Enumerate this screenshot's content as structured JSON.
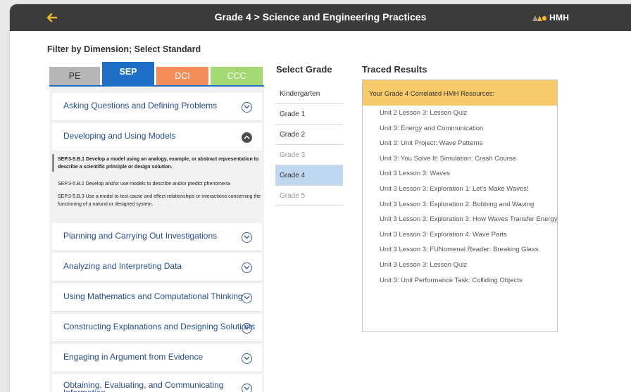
{
  "header": {
    "title": "Grade 4 > Science and Engineering Practices",
    "logo_text": "HMH"
  },
  "filter_label": "Filter by Dimension; Select Standard",
  "tabs": [
    {
      "label": "PE",
      "color": "#b6b6b6"
    },
    {
      "label": "SEP",
      "color": "#1f6fc8"
    },
    {
      "label": "DCI",
      "color": "#f58d5a"
    },
    {
      "label": "CCC",
      "color": "#a5d873"
    }
  ],
  "standards": [
    {
      "label": "Asking Questions and Defining Problems"
    },
    {
      "label": "Developing and Using Models"
    },
    {
      "label": "Planning and Carrying Out Investigations"
    },
    {
      "label": "Analyzing and Interpreting Data"
    },
    {
      "label": "Using Mathematics and Computational Thinking"
    },
    {
      "label": "Constructing Explanations and Designing Solutions"
    },
    {
      "label": "Engaging in Argument from Evidence"
    },
    {
      "label": "Obtaining, Evaluating, and Communicating Information"
    }
  ],
  "sub_standards": [
    "SEP.3-5.B.1 Develop a model using an analogy, example, or abstract representation to describe a scientific principle or design solution.",
    "SEP.3-5.B.2 Develop and/or use models to describe and/or predict phenomena",
    "SEP.3-5.B.3 Use a model to test cause and effect relationships or interactions concerning the functioning of a natural or designed system."
  ],
  "grades": {
    "title": "Select Grade",
    "items": [
      "Kindergarten",
      "Grade 1",
      "Grade 2",
      "Grade 3",
      "Grade 4",
      "Grade 5"
    ]
  },
  "traced": {
    "title": "Traced Results",
    "header": "Your Grade 4 Correlated HMH Resources:",
    "items": [
      "Unit 2 Lesson 3: Lesson Quiz",
      "Unit 3: Energy and Communication",
      "Unit 3: Unit Project: Wave Patterns",
      "Unit 3: You Solve It! Simulation: Crash Course",
      "Unit 3 Lesson 3: Waves",
      "Unit 3 Lesson 3: Exploration 1: Let's Make Waves!",
      "Unit 3 Lesson 3: Exploration 2: Bobbing and Waving",
      "Unit 3 Lesson 3: Exploration 3: How Waves Transfer Energy",
      "Unit 3 Lesson 3: Exploration 4: Wave Parts",
      "Unit 3 Lesson 3: FUNomenal Reader: Breaking Glass",
      "Unit 3 Lesson 3: Lesson Quiz",
      "Unit 3: Unit Performance Task: Colliding Objects"
    ]
  },
  "colors": {
    "accent": "#1f6fc8",
    "topbar": "#3b3b3b",
    "highlight": "#f6c96a",
    "arrow": "#f2b431"
  }
}
